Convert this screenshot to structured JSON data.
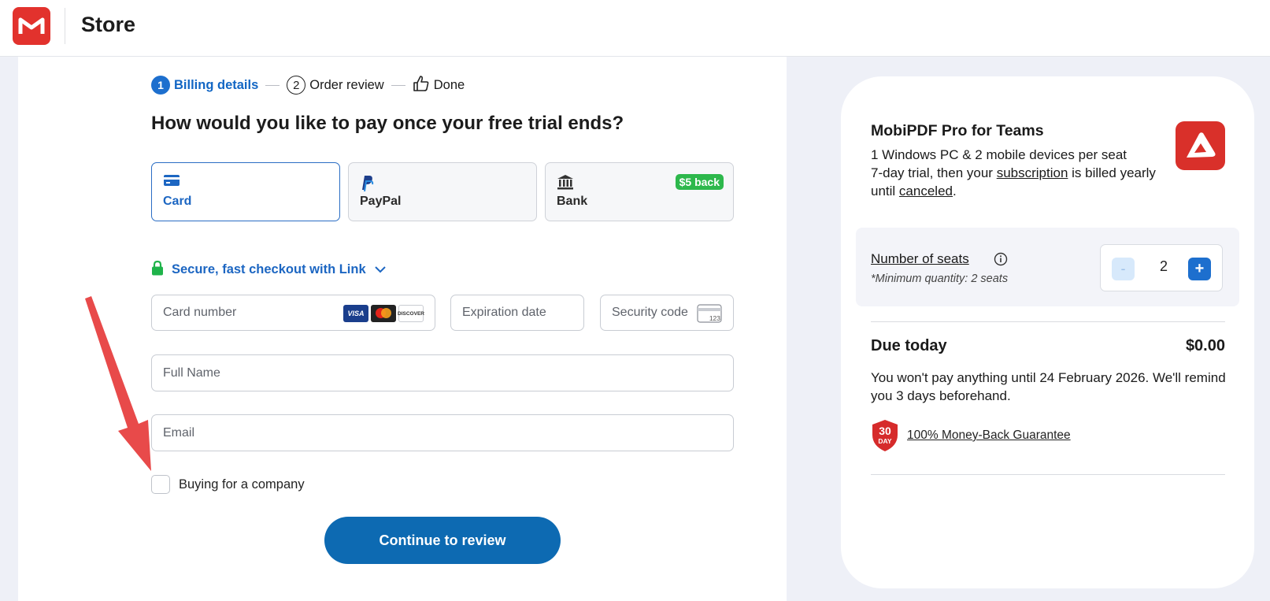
{
  "header": {
    "title": "Store"
  },
  "stepper": [
    {
      "num": "1",
      "label": "Billing details",
      "active": true
    },
    {
      "num": "2",
      "label": "Order review",
      "active": false
    },
    {
      "label": "Done",
      "active": false
    }
  ],
  "heading": "How would you like to pay once your free trial ends?",
  "payment_methods": [
    {
      "label": "Card",
      "selected": true
    },
    {
      "label": "PayPal",
      "selected": false
    },
    {
      "label": "Bank",
      "selected": false,
      "badge": "$5 back"
    }
  ],
  "link_checkout": "Secure, fast checkout with Link",
  "fields": {
    "card_number": "Card number",
    "expiration": "Expiration date",
    "security_code": "Security code",
    "full_name": "Full Name",
    "email": "Email"
  },
  "card_brands": [
    "VISA",
    "Mastercard",
    "DISCOVER"
  ],
  "cvc_hint": "123",
  "company_checkbox": {
    "label": "Buying for a company",
    "checked": false
  },
  "continue_label": "Continue to review",
  "summary": {
    "product_title": "MobiPDF Pro for Teams",
    "desc_line1": "1 Windows PC & 2 mobile devices per seat",
    "desc_pre": "7-day trial, then your ",
    "desc_link1": "subscription",
    "desc_mid": " is billed yearly until ",
    "desc_link2": "canceled",
    "desc_end": ".",
    "seats_label": "Number of seats",
    "seats_note": "*Minimum quantity: 2 seats",
    "seats_value": "2",
    "minus": "-",
    "plus": "+",
    "due_label": "Due today",
    "due_amount": "$0.00",
    "due_note": "You won't pay anything until 24 February 2026. We'll remind you 3 days beforehand.",
    "guarantee_badge_top": "30",
    "guarantee_badge_bottom": "DAY",
    "guarantee_label": "100% Money-Back Guarantee"
  },
  "colors": {
    "accent": "#1d6fce",
    "button": "#0d6ab2",
    "brand_red": "#e2322d",
    "badge_green": "#2db84c"
  }
}
